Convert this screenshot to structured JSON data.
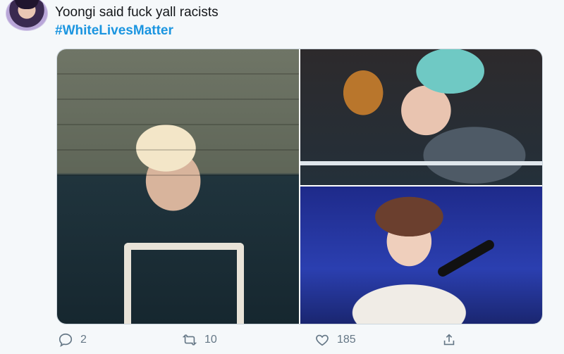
{
  "tweet": {
    "text": "Yoongi said fuck yall racists",
    "hashtag": "#WhiteLivesMatter"
  },
  "actions": {
    "reply_count": "2",
    "retweet_count": "10",
    "like_count": "185"
  },
  "colors": {
    "hashtag": "#1b95e0",
    "action": "#657786",
    "background": "#f5f8fa"
  }
}
